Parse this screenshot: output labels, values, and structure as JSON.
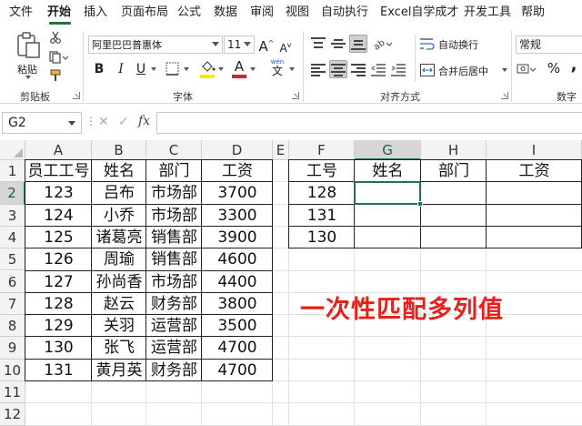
{
  "tabs": [
    "文件",
    "开始",
    "插入",
    "页面布局",
    "公式",
    "数据",
    "审阅",
    "视图",
    "自动执行",
    "Excel自学成才",
    "开发工具",
    "帮助"
  ],
  "active_tab": "开始",
  "ribbon": {
    "clipboard": {
      "paste_label": "粘贴",
      "group_label": "剪贴板"
    },
    "font": {
      "font_name": "阿里巴巴普惠体",
      "font_size": "11",
      "group_label": "字体",
      "grow_label": "A",
      "shrink_label": "A",
      "bold": "B",
      "italic": "I",
      "underline": "U",
      "wen_label": "wén",
      "wen_char": "文"
    },
    "alignment": {
      "wrap_text": "自动换行",
      "merge_center": "合并后居中",
      "group_label": "对齐方式"
    },
    "number": {
      "format": "常规",
      "group_label": "数字",
      "percent": "%",
      "comma": ","
    },
    "colors": {
      "fill": "#ffe600",
      "font": "#e81c1c"
    }
  },
  "formula_bar": {
    "name_box": "G2",
    "cancel": "✕",
    "enter": "✓",
    "fx": "fx",
    "formula": ""
  },
  "columns": [
    "A",
    "B",
    "C",
    "D",
    "E",
    "F",
    "G",
    "H",
    "I"
  ],
  "rows": [
    "1",
    "2",
    "3",
    "4",
    "5",
    "6",
    "7",
    "8",
    "9",
    "10",
    "11",
    "12"
  ],
  "selected_cell": "G2",
  "table_left": {
    "headers": [
      "员工工号",
      "姓名",
      "部门",
      "工资"
    ],
    "rows": [
      [
        "123",
        "吕布",
        "市场部",
        "3700"
      ],
      [
        "124",
        "小乔",
        "市场部",
        "3300"
      ],
      [
        "125",
        "诸葛亮",
        "销售部",
        "3900"
      ],
      [
        "126",
        "周瑜",
        "销售部",
        "4600"
      ],
      [
        "127",
        "孙尚香",
        "市场部",
        "4400"
      ],
      [
        "128",
        "赵云",
        "财务部",
        "3800"
      ],
      [
        "129",
        "关羽",
        "运营部",
        "3500"
      ],
      [
        "130",
        "张飞",
        "运营部",
        "4700"
      ],
      [
        "131",
        "黄月英",
        "财务部",
        "4700"
      ]
    ]
  },
  "table_right": {
    "headers": [
      "工号",
      "姓名",
      "部门",
      "工资"
    ],
    "rows": [
      [
        "128",
        "",
        "",
        ""
      ],
      [
        "131",
        "",
        "",
        ""
      ],
      [
        "130",
        "",
        "",
        ""
      ]
    ]
  },
  "title_text": "一次性匹配多列值"
}
